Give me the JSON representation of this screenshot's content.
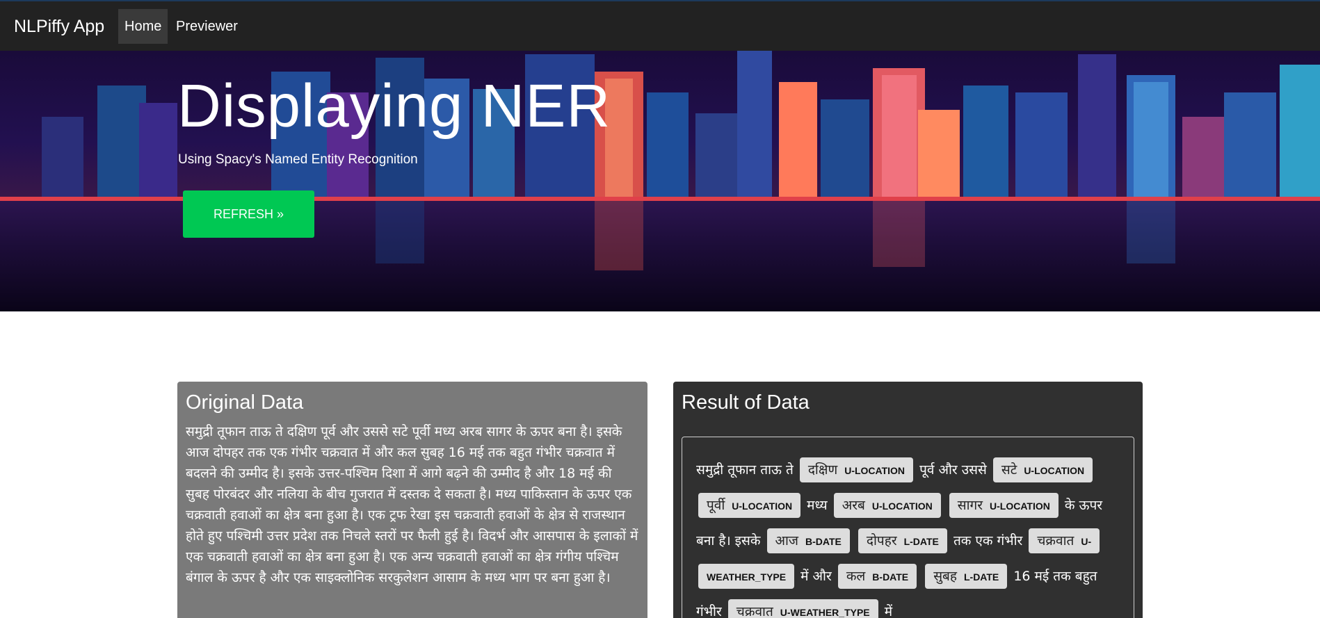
{
  "navbar": {
    "brand": "NLPiffy App",
    "items": [
      "Home",
      "Previewer"
    ]
  },
  "hero": {
    "title": "Displaying NER",
    "subtitle": "Using Spacy's Named Entity Recognition",
    "button_label": "REFRESH »"
  },
  "original_card": {
    "title": "Original Data",
    "text": "समुद्री तूफान ताऊ ते दक्षिण पूर्व और उससे सटे पूर्वी मध्य अरब सागर के ऊपर बना है। इसके आज दोपहर तक एक गंभीर चक्रवात में और कल सुबह 16 मई तक बहुत गंभीर चक्रवात में बदलने की उम्मीद है। इसके उत्तर-पश्चिम दिशा में आगे बढ़ने की उम्मीद है और 18 मई की सुबह पोरबंदर और नलिया के बीच गुजरात में दस्तक दे सकता है। मध्य पाकिस्तान के ऊपर एक चक्रवाती हवाओं का क्षेत्र बना हुआ है। एक ट्रफ रेखा इस चक्रवाती हवाओं के क्षेत्र से राजस्थान होते हुए पश्चिमी उत्तर प्रदेश तक निचले स्तरों पर फैली हुई है। विदर्भ और आसपास के इलाकों में एक चक्रवाती हवाओं का क्षेत्र बना हुआ है। एक अन्य चक्रवाती हवाओं का क्षेत्र गंगीय पश्चिम बंगाल के ऊपर है और एक साइक्लोनिक सरकुलेशन आसाम के मध्य भाग पर बना हुआ है।"
  },
  "result_card": {
    "title": "Result of Data",
    "segments": [
      {
        "text": "समुद्री तूफान ताऊ ते"
      },
      {
        "text": "दक्षिण",
        "label": "U-LOCATION"
      },
      {
        "text": "पूर्व और उससे"
      },
      {
        "text": "सटे",
        "label": "U-LOCATION"
      },
      {
        "text": "पूर्वी",
        "label": "U-LOCATION"
      },
      {
        "text": "मध्य"
      },
      {
        "text": "अरब",
        "label": "U-LOCATION"
      },
      {
        "text": "सागर",
        "label": "U-LOCATION"
      },
      {
        "text": "के ऊपर बना है। इसके"
      },
      {
        "text": "आज",
        "label": "B-DATE"
      },
      {
        "text": "दोपहर",
        "label": "L-DATE"
      },
      {
        "text": "तक एक गंभीर"
      },
      {
        "text": "चक्रवात",
        "label": "U-WEATHER_TYPE"
      },
      {
        "text": "में और"
      },
      {
        "text": "कल",
        "label": "B-DATE"
      },
      {
        "text": "सुबह",
        "label": "L-DATE"
      },
      {
        "text": "16 मई तक बहुत गंभीर"
      },
      {
        "text": "चक्रवात",
        "label": "U-WEATHER_TYPE"
      },
      {
        "text": "में"
      }
    ]
  },
  "colors": {
    "navbar_bg": "#222222",
    "nav_active_bg": "#3a3a3a",
    "button_green": "#00c853",
    "original_card_bg": "#7a7a7a",
    "result_card_bg": "#303030",
    "entity_bg": "#dddddd"
  }
}
